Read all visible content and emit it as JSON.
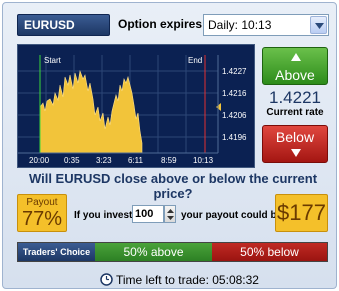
{
  "header": {
    "asset": "EURUSD",
    "expires_label": "Option expires at",
    "expiry_selected": "Daily: 10:13"
  },
  "chart": {
    "start_label": "Start",
    "end_label": "End",
    "y_ticks": [
      "1.4227",
      "1.4216",
      "1.4206",
      "1.4196"
    ],
    "x_ticks": [
      "20:00",
      "0:35",
      "3:23",
      "6:11",
      "8:59",
      "10:13"
    ],
    "current_rate_marker": 1.4206
  },
  "actions": {
    "above_label": "Above",
    "below_label": "Below",
    "current_rate_value": "1.4221",
    "current_rate_label": "Current rate"
  },
  "question": "Will EURUSD close above or below the current price?",
  "payout": {
    "title": "Payout",
    "percent": "77%",
    "invest_label": "If you invest",
    "invest_value": "100",
    "payout_label": "your payout could be",
    "payout_amount": "$177"
  },
  "traders_choice": {
    "label": "Traders' Choice",
    "above": "50% above",
    "below": "50% below"
  },
  "time_left": "Time left to trade: 05:08:32",
  "colors": {
    "navy": "#1d3764",
    "above_green": "#2d8c1a",
    "below_red": "#a41612",
    "payout_gold": "#f4c02a",
    "chart_area": "#f2c43a"
  }
}
